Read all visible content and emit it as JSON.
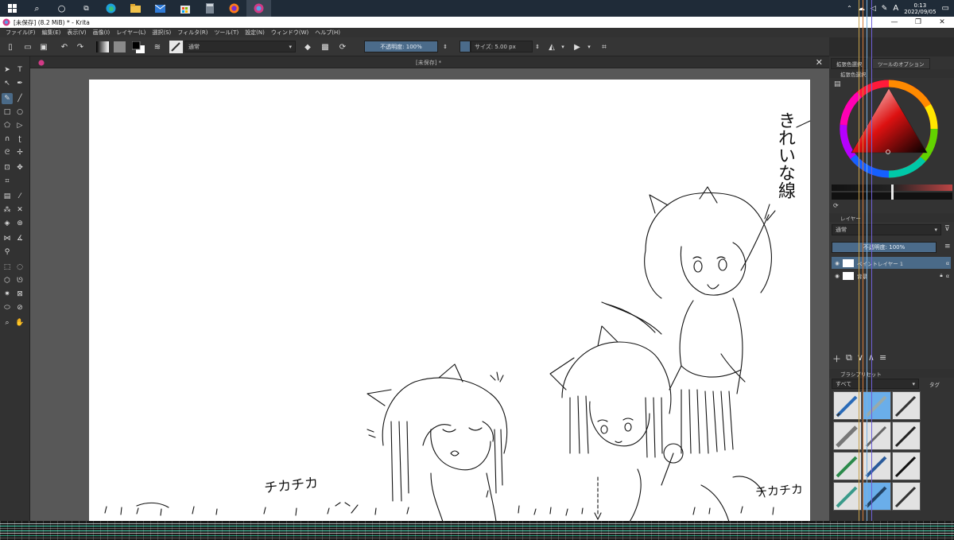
{
  "taskbar": {
    "icons": [
      "windows-icon",
      "search-icon",
      "cortana-icon",
      "task-view-icon",
      "edge-icon",
      "explorer-icon",
      "mail-icon",
      "calculator-icon",
      "firefox-icon",
      "krita-icon"
    ],
    "time": "0:13",
    "date": "2022/09/05",
    "ime": "A"
  },
  "title": {
    "text": "[未保存] (8.2 MiB) * - Krita",
    "minimize": "—",
    "maximize": "❐",
    "close": "✕"
  },
  "menu": [
    "ファイル(F)",
    "編集(E)",
    "表示(V)",
    "画像(I)",
    "レイヤー(L)",
    "選択(S)",
    "フィルタ(R)",
    "ツール(T)",
    "設定(N)",
    "ウィンドウ(W)",
    "ヘルプ(H)"
  ],
  "toolbar": {
    "blend_mode": "通常",
    "opacity": "不透明度: 100%",
    "size": "サイズ: 5.00 px"
  },
  "document": {
    "tab_title": "[未保存] *",
    "close": "✕"
  },
  "canvas_text": {
    "kirei_line": "きれいな線",
    "chika_left": "チカチカ",
    "chika_right": "チカチカ"
  },
  "dock": {
    "tabs": [
      "拡張色選択",
      "ツールのオプション"
    ],
    "color_panel_title": "拡張色選択",
    "layers_title": "レイヤー",
    "layer_blend": "通常",
    "layer_opacity": "不透明度: 100%",
    "layers": [
      {
        "name": "ペイントレイヤー 1",
        "active": true
      },
      {
        "name": "背景",
        "active": false
      }
    ],
    "brush_title": "ブラシプリセット",
    "brush_filter": "すべて",
    "brush_tag": "タグ"
  },
  "colors": {
    "selection": "#4a6a88",
    "taskbar": "#1f2b38"
  }
}
